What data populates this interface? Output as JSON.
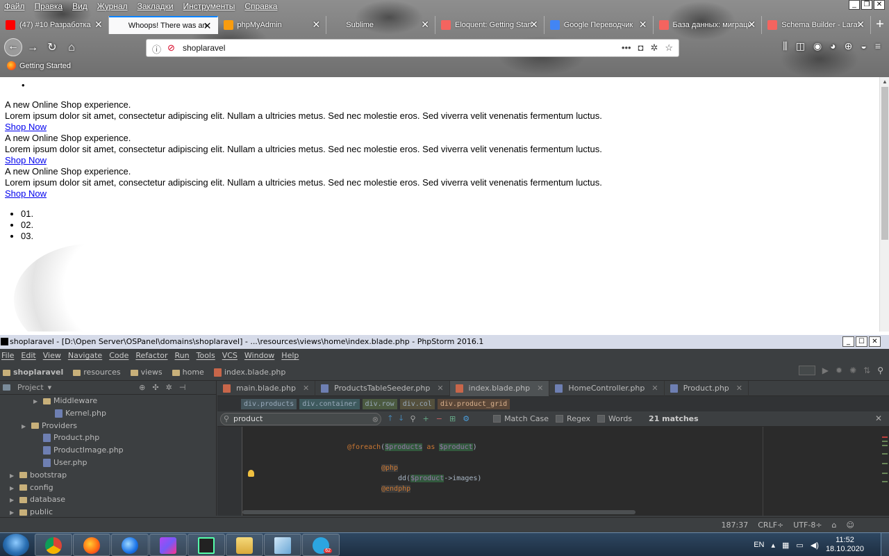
{
  "firefox": {
    "menu": [
      "Файл",
      "Правка",
      "Вид",
      "Журнал",
      "Закладки",
      "Инструменты",
      "Справка"
    ],
    "tabs": [
      {
        "title": "(47) #10 Разработка",
        "icon_color": "#ff0000"
      },
      {
        "title": "Whoops! There was an error",
        "icon_color": "#f9f9fa"
      },
      {
        "title": "phpMyAdmin",
        "icon_color": "#f89c0e"
      },
      {
        "title": "Sublime",
        "icon_color": "transparent"
      },
      {
        "title": "Eloquent: Getting Started",
        "icon_color": "#f4645f"
      },
      {
        "title": "Google Переводчик",
        "icon_color": "#4285f4"
      },
      {
        "title": "База данных: миграции",
        "icon_color": "#f4645f"
      },
      {
        "title": "Schema Builder - Laravel",
        "icon_color": "#f4645f"
      }
    ],
    "active_tab_index": 1,
    "url": "shoplaravel",
    "bookmark": "Getting Started"
  },
  "page": {
    "slides": [
      {
        "heading": "A new Online Shop experience.",
        "text": "Lorem ipsum dolor sit amet, consectetur adipiscing elit. Nullam a ultricies metus. Sed nec molestie eros. Sed viverra velit venenatis fermentum luctus.",
        "link": "Shop Now"
      },
      {
        "heading": "A new Online Shop experience.",
        "text": "Lorem ipsum dolor sit amet, consectetur adipiscing elit. Nullam a ultricies metus. Sed nec molestie eros. Sed viverra velit venenatis fermentum luctus.",
        "link": "Shop Now"
      },
      {
        "heading": "A new Online Shop experience.",
        "text": "Lorem ipsum dolor sit amet, consectetur adipiscing elit. Nullam a ultricies metus. Sed nec molestie eros. Sed viverra velit venenatis fermentum luctus.",
        "link": "Shop Now"
      }
    ],
    "indicators": [
      "01.",
      "02.",
      "03."
    ]
  },
  "phpstorm": {
    "title": "shoplaravel - [D:\\Open Server\\OSPanel\\domains\\shoplaravel] - ...\\resources\\views\\home\\index.blade.php - PhpStorm 2016.1",
    "menu": [
      "File",
      "Edit",
      "View",
      "Navigate",
      "Code",
      "Refactor",
      "Run",
      "Tools",
      "VCS",
      "Window",
      "Help"
    ],
    "breadcrumbs": [
      "shoplaravel",
      "resources",
      "views",
      "home",
      "index.blade.php"
    ],
    "project_label": "Project",
    "tree": [
      {
        "label": "Middleware",
        "type": "folder",
        "indent": 2,
        "arrow": "▶"
      },
      {
        "label": "Kernel.php",
        "type": "php",
        "indent": 3,
        "arrow": ""
      },
      {
        "label": "Providers",
        "type": "folder",
        "indent": 1,
        "arrow": "▶"
      },
      {
        "label": "Product.php",
        "type": "php",
        "indent": 2,
        "arrow": ""
      },
      {
        "label": "ProductImage.php",
        "type": "php",
        "indent": 2,
        "arrow": ""
      },
      {
        "label": "User.php",
        "type": "php",
        "indent": 2,
        "arrow": ""
      },
      {
        "label": "bootstrap",
        "type": "folder",
        "indent": 0,
        "arrow": "▶"
      },
      {
        "label": "config",
        "type": "folder",
        "indent": 0,
        "arrow": "▶"
      },
      {
        "label": "database",
        "type": "folder",
        "indent": 0,
        "arrow": "▶"
      },
      {
        "label": "public",
        "type": "folder",
        "indent": 0,
        "arrow": "▶"
      }
    ],
    "editor_tabs": [
      "main.blade.php",
      "ProductsTableSeeder.php",
      "index.blade.php",
      "HomeController.php",
      "Product.php"
    ],
    "active_editor_tab": 2,
    "html_crumbs": [
      "div.products",
      "div.container",
      "div.row",
      "div.col",
      "div.product_grid"
    ],
    "find": {
      "query": "product",
      "match_case": "Match Case",
      "regex": "Regex",
      "words": "Words",
      "matches": "21 matches"
    },
    "code": {
      "foreach_kw": "@foreach",
      "foreach_open": "(",
      "foreach_var1": "$products",
      "foreach_as": " as ",
      "foreach_var2": "$product",
      "foreach_close": ")",
      "php_kw": "@php",
      "dd_call": "dd(",
      "dd_var": "$product",
      "dd_rest": "->images)",
      "endphp_kw": "@endphp"
    },
    "status": {
      "position": "187:37",
      "line_sep": "CRLF÷",
      "encoding": "UTF-8÷"
    }
  },
  "taskbar": {
    "lang": "EN",
    "time": "11:52",
    "date": "18.10.2020",
    "telegram_badge": "62"
  }
}
